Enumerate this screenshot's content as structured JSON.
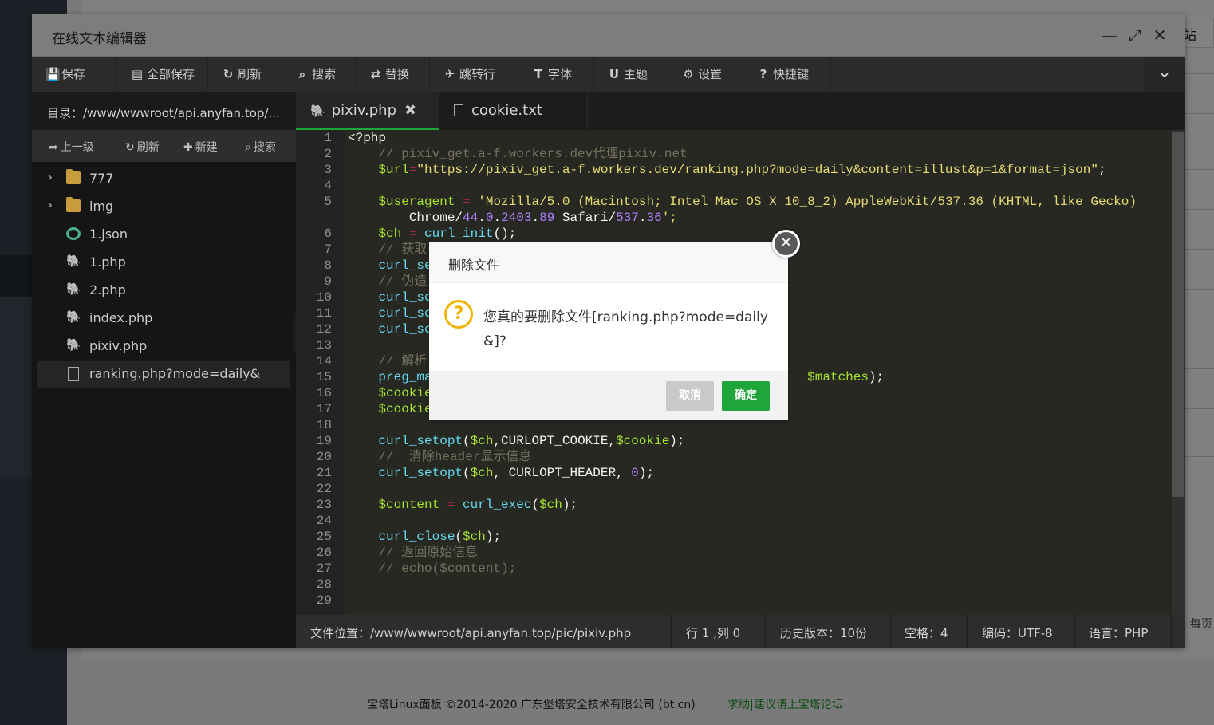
{
  "window": {
    "title": "在线文本编辑器",
    "controls": {
      "minimize": "—",
      "maximize": "⤢",
      "close": "✕"
    }
  },
  "toolbar": {
    "items": [
      {
        "icon": "save-icon",
        "glyph": "💾",
        "label": "保存"
      },
      {
        "icon": "save-all-icon",
        "glyph": "▤",
        "label": "全部保存"
      },
      {
        "icon": "refresh-icon",
        "glyph": "↻",
        "label": "刷新"
      },
      {
        "icon": "search-icon",
        "glyph": "⌕",
        "label": "搜索"
      },
      {
        "icon": "replace-icon",
        "glyph": "⇄",
        "label": "替换"
      },
      {
        "icon": "goto-line-icon",
        "glyph": "✈",
        "label": "跳转行"
      },
      {
        "icon": "font-icon",
        "glyph": "T",
        "label": "字体"
      },
      {
        "icon": "theme-icon",
        "glyph": "U",
        "label": "主题"
      },
      {
        "icon": "settings-icon",
        "glyph": "⚙",
        "label": "设置"
      },
      {
        "icon": "help-icon",
        "glyph": "?",
        "label": "快捷键"
      }
    ],
    "toggle_glyph": "⌄"
  },
  "file_tree": {
    "path": "目录：/www/wwwroot/api.anyfan.top/...",
    "actions": [
      {
        "glyph": "➦",
        "label": "上一级"
      },
      {
        "glyph": "↻",
        "label": "刷新"
      },
      {
        "glyph": "✚",
        "label": "新建"
      },
      {
        "glyph": "⌕",
        "label": "搜索"
      }
    ],
    "items": [
      {
        "type": "folder",
        "name": "777"
      },
      {
        "type": "folder",
        "name": "img"
      },
      {
        "type": "json",
        "name": "1.json"
      },
      {
        "type": "php",
        "name": "1.php"
      },
      {
        "type": "php",
        "name": "2.php"
      },
      {
        "type": "php",
        "name": "index.php"
      },
      {
        "type": "php",
        "name": "pixiv.php"
      },
      {
        "type": "file",
        "name": "ranking.php?mode=daily&"
      }
    ],
    "collapse_glyph": "‹"
  },
  "tabs": [
    {
      "label": "pixiv.php",
      "close": "✖",
      "active": true
    },
    {
      "label": "cookie.txt",
      "active": false
    }
  ],
  "code": {
    "line_numbers": [
      "1",
      "2",
      "3",
      "4",
      "5",
      "",
      "6",
      "7",
      "8",
      "9",
      "10",
      "11",
      "12",
      "13",
      "14",
      "15",
      "16",
      "17",
      "18",
      "19",
      "20",
      "21",
      "22",
      "23",
      "24",
      "25",
      "26",
      "27",
      "28",
      "29"
    ],
    "lines": [
      "<?php",
      "    // pixiv_get.a-f.workers.dev代理pixiv.net",
      "    $url=\"https://pixiv_get.a-f.workers.dev/ranking.php?mode=daily&content=illust&p=1&format=json\";",
      "",
      "    $useragent = 'Mozilla/5.0 (Macintosh; Intel Mac OS X 10_8_2) AppleWebKit/537.36 (KHTML, like Gecko)",
      "        Chrome/44.0.2403.89 Safari/537.36';",
      "    $ch = curl_init();",
      "    // 获取",
      "    curl_se",
      "    // 伪造",
      "    curl_se",
      "    curl_se",
      "    curl_se",
      "",
      "    // 解析",
      "    preg_ma                                                 $matches);",
      "    $cookie",
      "    $cookie",
      "",
      "    curl_setopt($ch,CURLOPT_COOKIE,$cookie);",
      "    //  清除header显示信息",
      "    curl_setopt($ch, CURLOPT_HEADER, 0);",
      "",
      "    $content = curl_exec($ch);",
      "",
      "    curl_close($ch);",
      "    // 返回原始信息",
      "    // echo($content);",
      "",
      ""
    ]
  },
  "statusbar": {
    "location": "文件位置：/www/wwwroot/api.anyfan.top/pic/pixiv.php",
    "cursor": "行 1 ,列 0",
    "history": "历史版本：10份",
    "indent": "空格：4",
    "encoding": "编码：UTF-8",
    "language": "语言：PHP"
  },
  "dialog": {
    "title": "删除文件",
    "icon": "question-icon",
    "message": "您真的要删除文件[ranking.php?mode=daily&]?",
    "cancel_label": "取消",
    "ok_label": "确定",
    "close_glyph": "✕"
  },
  "background": {
    "right_button": "站",
    "right_text": "每页",
    "footer_copyright": "宝塔Linux面板 ©2014-2020 广东堡塔安全技术有限公司 (bt.cn)",
    "footer_help": "求助|建议请上宝塔论坛"
  },
  "colors": {
    "accent": "#20a53a",
    "warning": "#f0b400",
    "editor_bg": "#272822"
  }
}
